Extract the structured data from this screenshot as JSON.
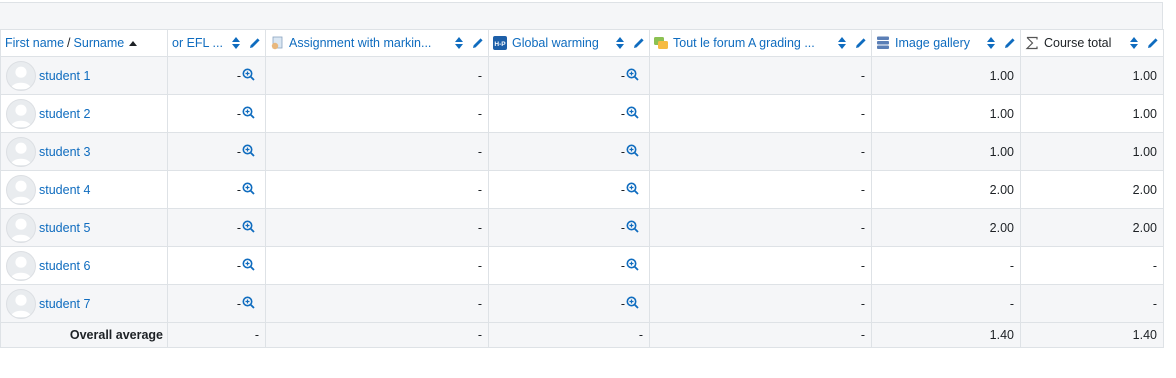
{
  "header": {
    "first_name": "First name",
    "separator": "/",
    "surname": "Surname",
    "columns": [
      {
        "title": "or EFL ...",
        "icon": "none"
      },
      {
        "title": "Assignment with markin...",
        "icon": "assignment-icon"
      },
      {
        "title": "Global warming",
        "icon": "h5p-icon"
      },
      {
        "title": "Tout le forum A grading ...",
        "icon": "forum-icon"
      },
      {
        "title": "Image gallery",
        "icon": "database-icon"
      },
      {
        "title": "Course total",
        "icon": "sigma-icon"
      }
    ]
  },
  "students": [
    {
      "name": "student 1",
      "c1": "-",
      "c2": "-",
      "c3": "-",
      "c4": "-",
      "c5": "1.00",
      "total": "1.00"
    },
    {
      "name": "student 2",
      "c1": "-",
      "c2": "-",
      "c3": "-",
      "c4": "-",
      "c5": "1.00",
      "total": "1.00"
    },
    {
      "name": "student 3",
      "c1": "-",
      "c2": "-",
      "c3": "-",
      "c4": "-",
      "c5": "1.00",
      "total": "1.00"
    },
    {
      "name": "student 4",
      "c1": "-",
      "c2": "-",
      "c3": "-",
      "c4": "-",
      "c5": "2.00",
      "total": "2.00"
    },
    {
      "name": "student 5",
      "c1": "-",
      "c2": "-",
      "c3": "-",
      "c4": "-",
      "c5": "2.00",
      "total": "2.00"
    },
    {
      "name": "student 6",
      "c1": "-",
      "c2": "-",
      "c3": "-",
      "c4": "-",
      "c5": "-",
      "total": "-"
    },
    {
      "name": "student 7",
      "c1": "-",
      "c2": "-",
      "c3": "-",
      "c4": "-",
      "c5": "-",
      "total": "-"
    }
  ],
  "average": {
    "label": "Overall average",
    "values": [
      "-",
      "-",
      "-",
      "-",
      "1.40",
      "1.40"
    ]
  },
  "colors": {
    "link": "#0f6cbf",
    "border": "#dee2e6",
    "stripe": "#f5f6f8"
  }
}
